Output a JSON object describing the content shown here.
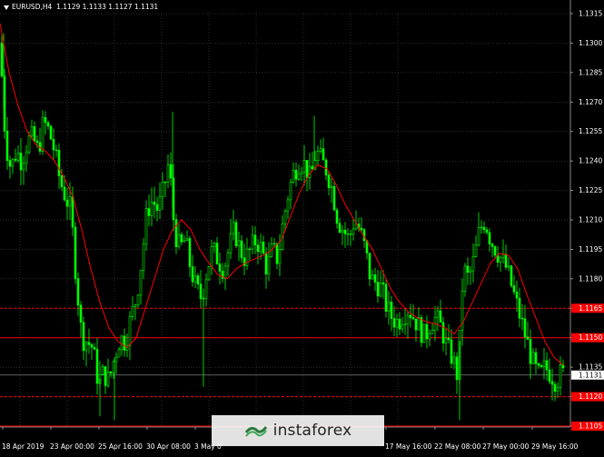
{
  "header": {
    "symbol": "EURUSD,H4",
    "ohlc": "1.1129 1.1133 1.1127 1.1131"
  },
  "watermark": {
    "text": "instaforex"
  },
  "colors": {
    "background": "#000000",
    "candle": "#00ff00",
    "moving_average": "#ff0000",
    "level_line": "#ff0000",
    "axis_text": "#ffffff",
    "grid": "#ffffff"
  },
  "chart_data": {
    "type": "candlestick",
    "y_axis": {
      "min": 1.1105,
      "max": 1.1315,
      "ticks": [
        "1.1315",
        "1.1300",
        "1.1285",
        "1.1270",
        "1.1255",
        "1.1240",
        "1.1225",
        "1.1210",
        "1.1195",
        "1.1180",
        "1.1165",
        "1.1150",
        "1.1135",
        "1.1120",
        "1.1105"
      ]
    },
    "x_axis": {
      "labels": [
        "18 Apr 2019",
        "23 Apr 00:00",
        "25 Apr 16:00",
        "30 Apr 08:00",
        "3 May 0",
        "17 May 16:00",
        "22 May 08:00",
        "27 May 00:00",
        "29 May 16:00"
      ]
    },
    "grid": true,
    "levels": [
      {
        "value": 1.1165,
        "label": "1.1165",
        "style": "dashed"
      },
      {
        "value": 1.115,
        "label": "1.1150",
        "style": "solid"
      },
      {
        "value": 1.112,
        "label": "1.1120",
        "style": "dashed"
      },
      {
        "value": 1.1105,
        "label": "1.1105",
        "style": "solid"
      }
    ],
    "current_price": {
      "value": 1.1131,
      "label": "1.1131"
    },
    "close_path": [
      [
        0,
        1.13
      ],
      [
        6,
        1.125
      ],
      [
        12,
        1.1236
      ],
      [
        18,
        1.1245
      ],
      [
        24,
        1.124
      ],
      [
        30,
        1.125
      ],
      [
        36,
        1.1252
      ],
      [
        42,
        1.1245
      ],
      [
        48,
        1.126
      ],
      [
        54,
        1.1255
      ],
      [
        60,
        1.1245
      ],
      [
        66,
        1.123
      ],
      [
        72,
        1.1222
      ],
      [
        78,
        1.1215
      ],
      [
        84,
        1.118
      ],
      [
        90,
        1.115
      ],
      [
        96,
        1.1148
      ],
      [
        102,
        1.1145
      ],
      [
        108,
        1.1128
      ],
      [
        114,
        1.1132
      ],
      [
        120,
        1.1128
      ],
      [
        126,
        1.114
      ],
      [
        132,
        1.115
      ],
      [
        138,
        1.1148
      ],
      [
        144,
        1.116
      ],
      [
        150,
        1.117
      ],
      [
        156,
        1.119
      ],
      [
        162,
        1.1215
      ],
      [
        168,
        1.122
      ],
      [
        174,
        1.1215
      ],
      [
        180,
        1.1225
      ],
      [
        186,
        1.124
      ],
      [
        192,
        1.1205
      ],
      [
        198,
        1.1195
      ],
      [
        204,
        1.12
      ],
      [
        210,
        1.1185
      ],
      [
        216,
        1.1175
      ],
      [
        222,
        1.117
      ],
      [
        228,
        1.1185
      ],
      [
        234,
        1.1195
      ],
      [
        240,
        1.119
      ],
      [
        246,
        1.1185
      ],
      [
        252,
        1.1195
      ],
      [
        258,
        1.1205
      ],
      [
        264,
        1.1195
      ],
      [
        270,
        1.119
      ],
      [
        276,
        1.1195
      ],
      [
        282,
        1.12
      ],
      [
        288,
        1.1195
      ],
      [
        294,
        1.1185
      ],
      [
        300,
        1.1195
      ],
      [
        306,
        1.119
      ],
      [
        312,
        1.121
      ],
      [
        318,
        1.1225
      ],
      [
        324,
        1.1235
      ],
      [
        330,
        1.124
      ],
      [
        336,
        1.1238
      ],
      [
        342,
        1.123
      ],
      [
        348,
        1.1245
      ],
      [
        354,
        1.124
      ],
      [
        360,
        1.1235
      ],
      [
        366,
        1.1225
      ],
      [
        372,
        1.121
      ],
      [
        378,
        1.1205
      ],
      [
        384,
        1.12
      ],
      [
        390,
        1.121
      ],
      [
        396,
        1.1205
      ],
      [
        402,
        1.1195
      ],
      [
        408,
        1.118
      ],
      [
        414,
        1.1178
      ],
      [
        420,
        1.1175
      ],
      [
        426,
        1.1165
      ],
      [
        432,
        1.116
      ],
      [
        438,
        1.1158
      ],
      [
        444,
        1.1162
      ],
      [
        450,
        1.1165
      ],
      [
        456,
        1.116
      ],
      [
        462,
        1.1155
      ],
      [
        468,
        1.115
      ],
      [
        474,
        1.1158
      ],
      [
        480,
        1.116
      ],
      [
        486,
        1.1155
      ],
      [
        492,
        1.1145
      ],
      [
        498,
        1.114
      ],
      [
        504,
        1.113
      ],
      [
        510,
        1.1185
      ],
      [
        516,
        1.118
      ],
      [
        522,
        1.119
      ],
      [
        528,
        1.1205
      ],
      [
        534,
        1.121
      ],
      [
        540,
        1.12
      ],
      [
        546,
        1.1195
      ],
      [
        552,
        1.119
      ],
      [
        558,
        1.1185
      ],
      [
        564,
        1.1175
      ],
      [
        570,
        1.1165
      ],
      [
        576,
        1.1155
      ],
      [
        582,
        1.1145
      ],
      [
        588,
        1.1135
      ],
      [
        594,
        1.113
      ],
      [
        600,
        1.1135
      ],
      [
        606,
        1.1132
      ],
      [
        612,
        1.1128
      ],
      [
        618,
        1.1132
      ],
      [
        622,
        1.1131
      ]
    ],
    "ma_path": [
      [
        0,
        1.131
      ],
      [
        10,
        1.1285
      ],
      [
        20,
        1.1268
      ],
      [
        30,
        1.1255
      ],
      [
        40,
        1.1248
      ],
      [
        50,
        1.1245
      ],
      [
        60,
        1.124
      ],
      [
        70,
        1.1232
      ],
      [
        80,
        1.1222
      ],
      [
        90,
        1.1205
      ],
      [
        100,
        1.1185
      ],
      [
        110,
        1.1168
      ],
      [
        120,
        1.1155
      ],
      [
        130,
        1.1148
      ],
      [
        140,
        1.1145
      ],
      [
        150,
        1.115
      ],
      [
        160,
        1.1165
      ],
      [
        170,
        1.118
      ],
      [
        180,
        1.1195
      ],
      [
        190,
        1.1205
      ],
      [
        200,
        1.121
      ],
      [
        210,
        1.1205
      ],
      [
        220,
        1.1195
      ],
      [
        230,
        1.1188
      ],
      [
        240,
        1.1182
      ],
      [
        250,
        1.118
      ],
      [
        260,
        1.1185
      ],
      [
        270,
        1.1188
      ],
      [
        280,
        1.119
      ],
      [
        290,
        1.1192
      ],
      [
        300,
        1.1195
      ],
      [
        310,
        1.12
      ],
      [
        320,
        1.1212
      ],
      [
        330,
        1.1224
      ],
      [
        340,
        1.1233
      ],
      [
        350,
        1.1238
      ],
      [
        360,
        1.1236
      ],
      [
        370,
        1.1228
      ],
      [
        380,
        1.1218
      ],
      [
        390,
        1.121
      ],
      [
        400,
        1.1202
      ],
      [
        410,
        1.1195
      ],
      [
        420,
        1.1185
      ],
      [
        430,
        1.1175
      ],
      [
        440,
        1.1168
      ],
      [
        450,
        1.1163
      ],
      [
        460,
        1.116
      ],
      [
        470,
        1.1158
      ],
      [
        480,
        1.1157
      ],
      [
        490,
        1.1155
      ],
      [
        500,
        1.1152
      ],
      [
        510,
        1.1158
      ],
      [
        520,
        1.1168
      ],
      [
        530,
        1.1178
      ],
      [
        540,
        1.1188
      ],
      [
        550,
        1.1193
      ],
      [
        560,
        1.1192
      ],
      [
        570,
        1.1185
      ],
      [
        580,
        1.1172
      ],
      [
        590,
        1.116
      ],
      [
        600,
        1.1148
      ],
      [
        610,
        1.114
      ],
      [
        620,
        1.1136
      ]
    ]
  }
}
